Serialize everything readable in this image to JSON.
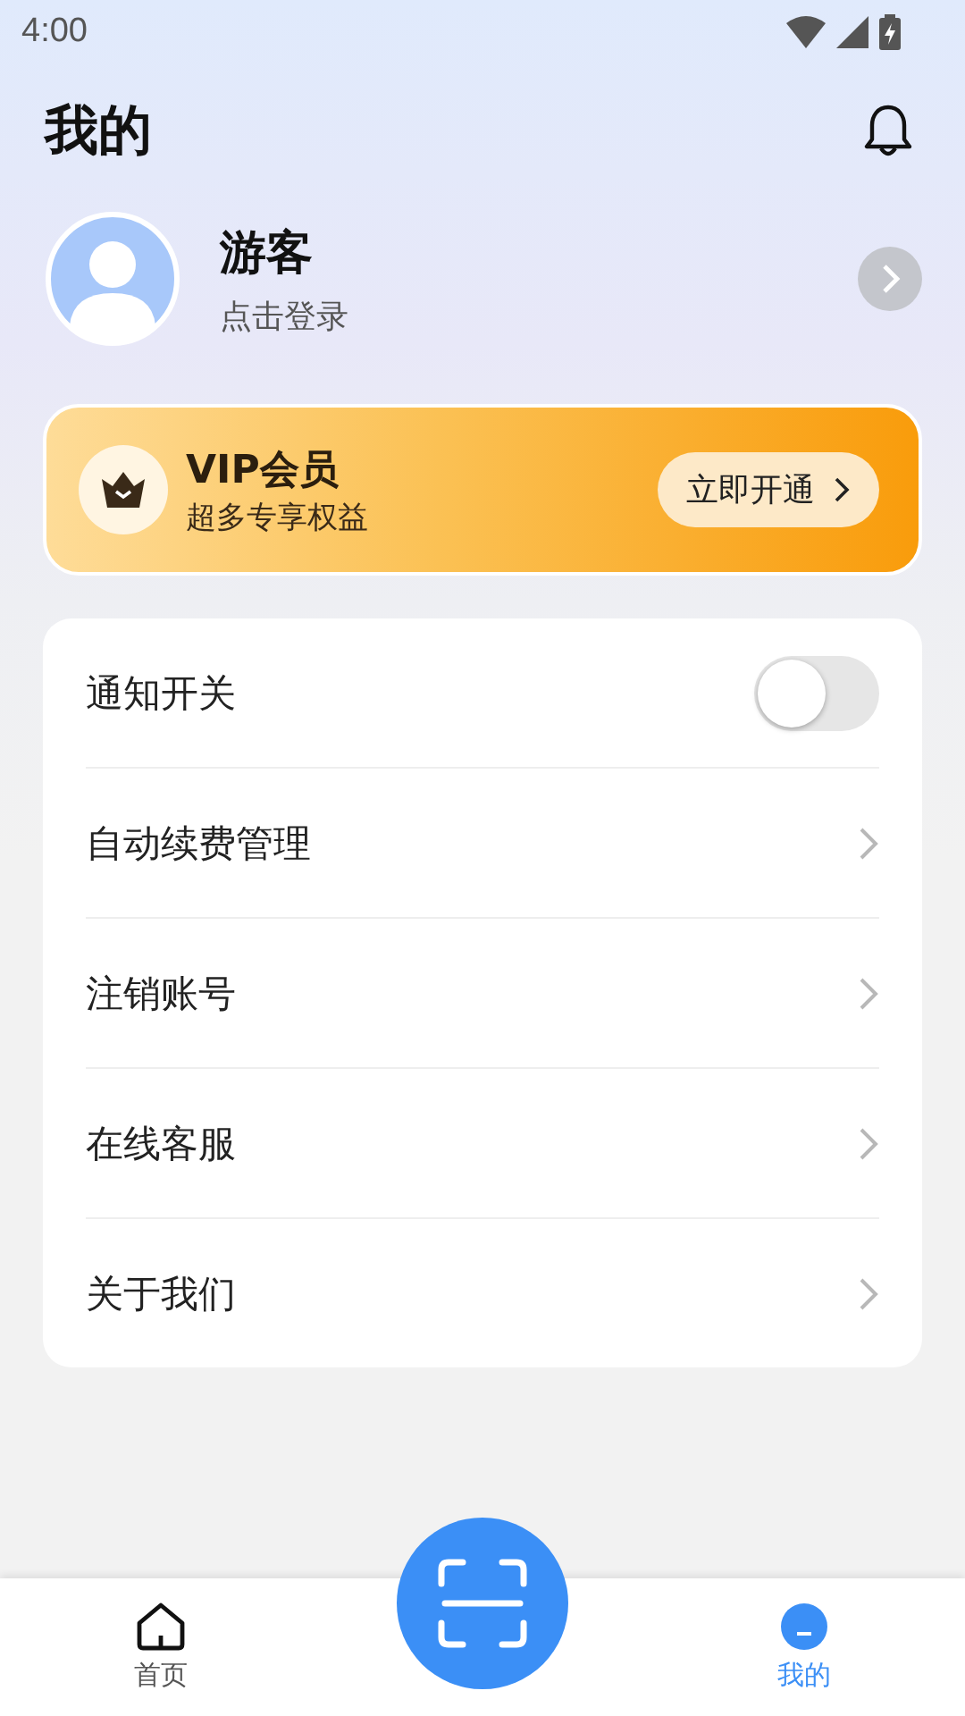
{
  "status_bar": {
    "time": "4:00"
  },
  "header": {
    "title": "我的"
  },
  "profile": {
    "name": "游客",
    "subtitle": "点击登录"
  },
  "vip_card": {
    "title": "VIP会员",
    "subtitle": "超多专享权益",
    "button": "立即开通"
  },
  "menu": [
    {
      "kind": "toggle",
      "label": "通知开关",
      "on": false
    },
    {
      "kind": "link",
      "label": "自动续费管理"
    },
    {
      "kind": "link",
      "label": "注销账号"
    },
    {
      "kind": "link",
      "label": "在线客服"
    },
    {
      "kind": "link",
      "label": "关于我们"
    }
  ],
  "bottom_nav": [
    {
      "kind": "home",
      "label": "首页",
      "selected": false
    },
    {
      "kind": "scan",
      "selected": false
    },
    {
      "kind": "profile",
      "label": "我的",
      "selected": true
    }
  ]
}
